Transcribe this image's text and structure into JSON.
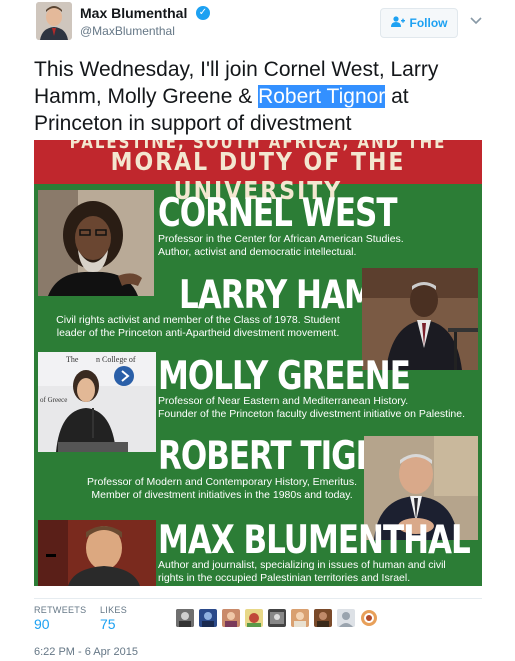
{
  "author": {
    "name": "Max Blumenthal",
    "handle": "@MaxBlumenthal",
    "verified_icon": "verified-badge-icon"
  },
  "actions": {
    "follow_label": "Follow",
    "more_icon": "chevron-down-icon"
  },
  "tweet": {
    "text_before": "This Wednesday, I'll join Cornel West, Larry Hamm, Molly Greene & ",
    "highlighted": "Robert Tignor",
    "text_after": " at Princeton in support of divestment"
  },
  "poster": {
    "title_line1": "PALESTINE, SOUTH AFRICA, AND THE",
    "title_line2": "MORAL DUTY OF THE UNIVERSITY",
    "speakers": [
      {
        "name": "CORNEL WEST",
        "desc_line1": "Professor in the Center for African American Studies.",
        "desc_line2": "Author, activist and democratic intellectual."
      },
      {
        "name": "LARRY HAMM",
        "desc_line1": "Civil rights activist and member of the Class of 1978. Student",
        "desc_line2": "leader of the Princeton anti-Apartheid divestment movement."
      },
      {
        "name": "MOLLY GREENE",
        "desc_line1": "Professor of Near Eastern and Mediterranean History.",
        "desc_line2": "Founder of the Princeton faculty divestment initiative on Palestine."
      },
      {
        "name": "ROBERT TIGNOR",
        "desc_line1": "Professor of Modern and Contemporary History, Emeritus.",
        "desc_line2": "Member of divestment initiatives in the 1980s and today."
      },
      {
        "name": "MAX BLUMENTHAL",
        "desc_line1": "Author and journalist, specializing in issues of human and civil",
        "desc_line2": "rights in the occupied Palestinian territories and Israel."
      }
    ],
    "photo_sign_text_1": "The",
    "photo_sign_text_2": "n College of",
    "photo_sign_text_3": "of Greece"
  },
  "stats": {
    "retweets_label": "RETWEETS",
    "retweets_value": "90",
    "likes_label": "LIKES",
    "likes_value": "75"
  },
  "timestamp": "6:22 PM - 6 Apr 2015",
  "colors": {
    "poster_green": "#2c7d36",
    "poster_red": "#c0272d",
    "twitter_blue": "#1da1f2",
    "highlight": "#3390ff"
  }
}
